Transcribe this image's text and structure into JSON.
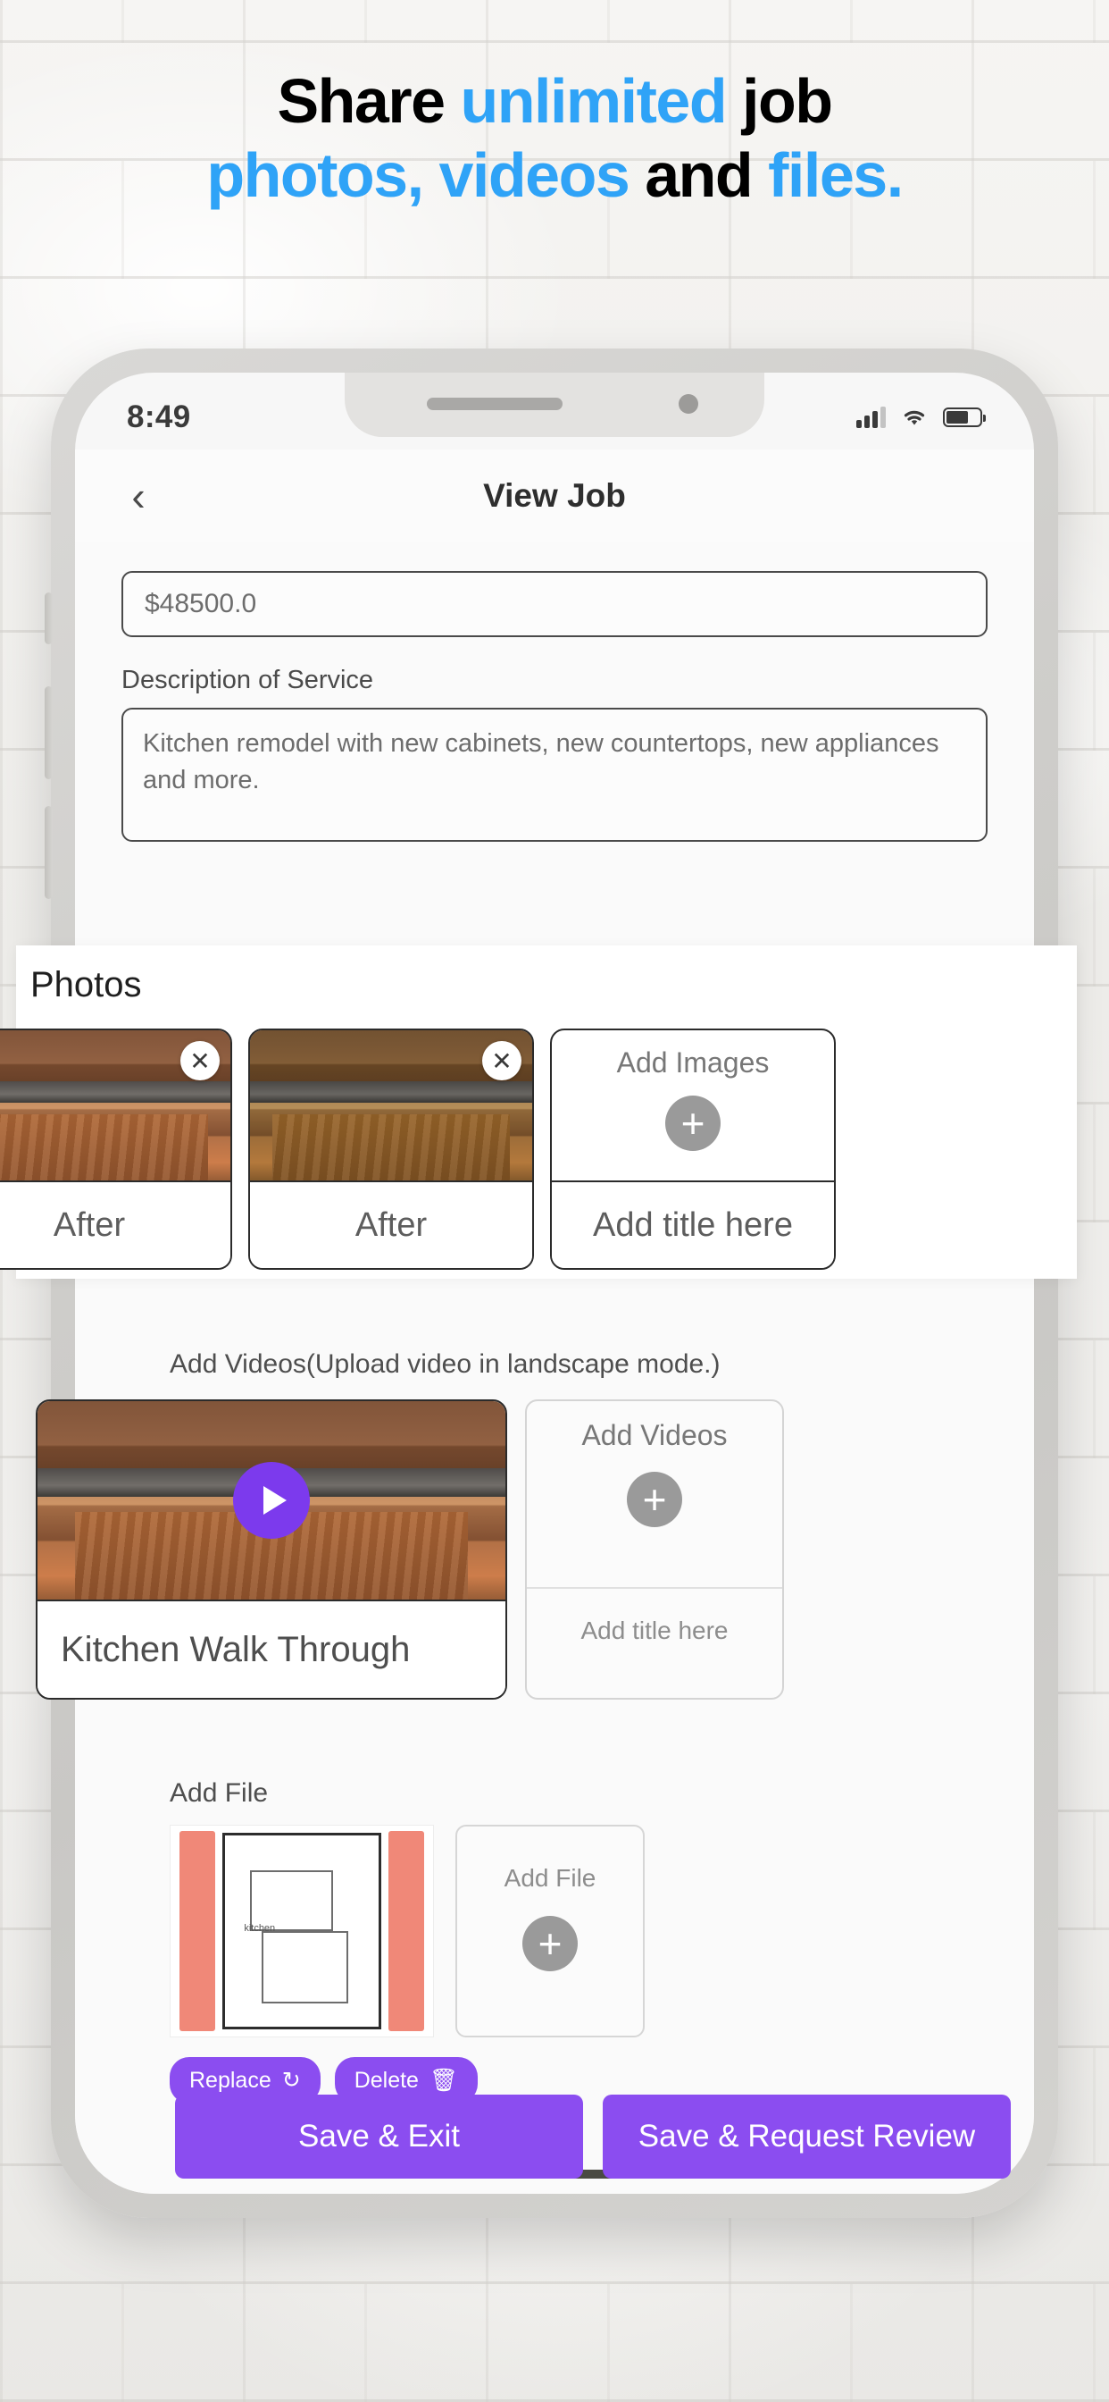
{
  "headline": {
    "line1_part1": "Share ",
    "line1_highlight": "unlimited",
    "line1_part2": " job",
    "line2_highlight1": "photos, videos",
    "line2_part1": " and ",
    "line2_highlight2": "files.",
    "accent_color": "#2fa3f7",
    "text_color": "#000000"
  },
  "phone": {
    "status": {
      "time": "8:49",
      "signal_icon": "signal-bars-icon",
      "wifi_icon": "wifi-icon",
      "battery_icon": "battery-icon"
    },
    "header": {
      "back_icon": "chevron-left-icon",
      "title": "View Job"
    }
  },
  "form": {
    "price_value": "$48500.0",
    "description_label": "Description of Service",
    "description_value": "Kitchen remodel with new cabinets, new countertops, new appliances and more."
  },
  "photos": {
    "section_title": "Photos",
    "cards": [
      {
        "caption": "r",
        "close_icon": "close-circle-icon"
      },
      {
        "caption": "After",
        "close_icon": "close-circle-icon"
      },
      {
        "caption": "After",
        "close_icon": "close-circle-icon"
      }
    ],
    "add_card": {
      "label": "Add Images",
      "plus_icon": "plus-circle-icon",
      "title_placeholder": "Add title here"
    }
  },
  "videos": {
    "section_label": "Add Videos(Upload video in landscape mode.)",
    "card": {
      "caption": "Kitchen Walk Through",
      "play_icon": "play-circle-icon"
    },
    "add_card": {
      "label": "Add Videos",
      "plus_icon": "plus-circle-icon",
      "title_placeholder": "Add title here"
    },
    "accent_color": "#7c3aed"
  },
  "file": {
    "section_label": "Add File",
    "add_card": {
      "label": "Add File",
      "plus_icon": "plus-circle-icon"
    },
    "chips": [
      {
        "label": "Replace",
        "icon": "refresh-icon",
        "glyph": "↻"
      },
      {
        "label": "Delete",
        "icon": "trash-icon",
        "glyph": "🗑"
      }
    ]
  },
  "actions": {
    "save_exit": "Save & Exit",
    "save_request_review": "Save & Request Review",
    "button_color": "#8b4df0"
  }
}
